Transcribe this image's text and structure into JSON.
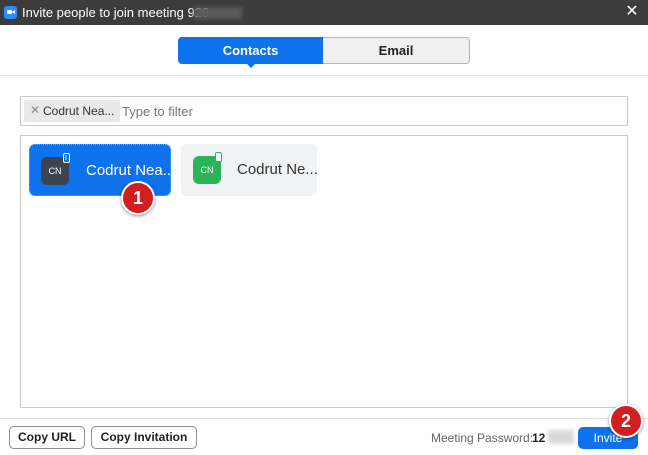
{
  "window": {
    "title": "Invite people to join meeting 928",
    "close_glyph": "✕",
    "app_icon": "zoom-camera-icon"
  },
  "tabs": [
    {
      "label": "Contacts",
      "selected": true
    },
    {
      "label": "Email",
      "selected": false
    }
  ],
  "filter": {
    "chip_label": "Codrut Nea...",
    "chip_remove_glyph": "✕",
    "placeholder": "Type to filter"
  },
  "contacts": [
    {
      "initials": "CN",
      "name": "Codrut Nea...",
      "selected": true,
      "avatar_color": "#3b4450"
    },
    {
      "initials": "CN",
      "name": "Codrut Ne...",
      "selected": false,
      "avatar_color": "#2bb35a"
    }
  ],
  "markers": [
    "1",
    "2"
  ],
  "footer": {
    "copy_url_label": "Copy URL",
    "copy_invitation_label": "Copy Invitation",
    "password_label": "Meeting Password:",
    "password_value": "12",
    "invite_label": "Invite"
  },
  "colors": {
    "accent": "#0e72ed",
    "titlebar": "#3c3c3c",
    "marker": "#d11f1f"
  }
}
